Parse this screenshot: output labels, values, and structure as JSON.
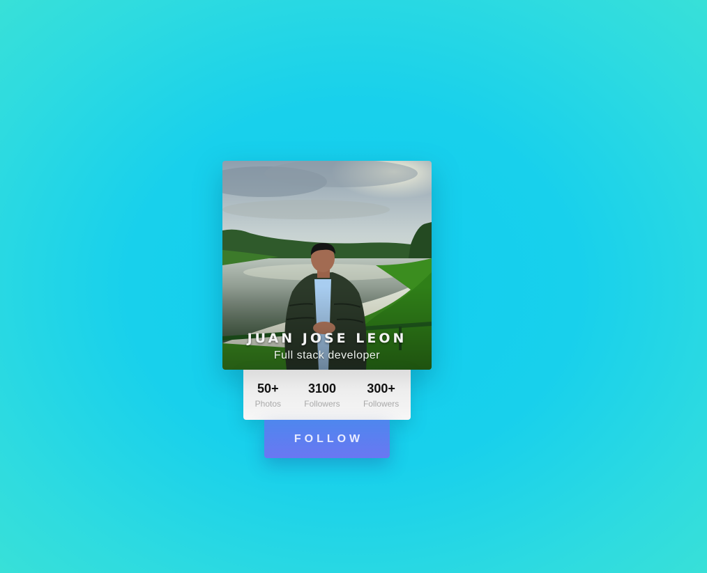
{
  "profile": {
    "name": "JUAN JOSE LEON",
    "role": "Full stack developer",
    "photo_icon": "profile-photo"
  },
  "stats": [
    {
      "value": "50+",
      "label": "Photos"
    },
    {
      "value": "3100",
      "label": "Followers"
    },
    {
      "value": "300+",
      "label": "Followers"
    }
  ],
  "follow_label": "FOLLOW",
  "colors": {
    "background": "#14cdee",
    "follow_button": "#5f7ef0",
    "stats_panel": "#f0f0f0"
  }
}
